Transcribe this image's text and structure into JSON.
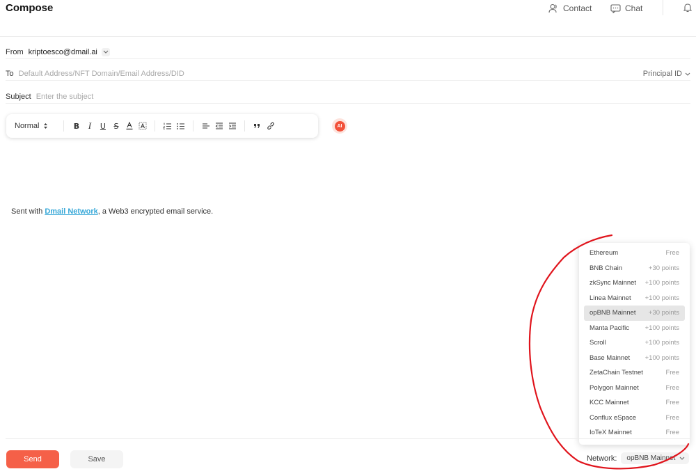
{
  "header": {
    "title": "Compose",
    "contact_label": "Contact",
    "chat_label": "Chat",
    "icons": [
      "contact-icon",
      "chat-icon",
      "bell-icon"
    ]
  },
  "form": {
    "from_label": "From",
    "from_value": "kriptoesco@dmail.ai",
    "to_label": "To",
    "to_placeholder": "Default Address/NFT Domain/Email Address/DID",
    "principal_label": "Principal ID",
    "subject_label": "Subject",
    "subject_placeholder": "Enter the subject"
  },
  "toolbar": {
    "format_value": "Normal",
    "bold": "B",
    "italic": "I",
    "underline": "U",
    "strike": "S",
    "font_color": "A",
    "ai_label": "AI",
    "icons": [
      "text-color-icon",
      "highlight-icon",
      "ordered-list-icon",
      "bullet-list-icon",
      "align-icon",
      "outdent-icon",
      "indent-icon",
      "quote-icon",
      "link-icon"
    ]
  },
  "body": {
    "sig_prefix": "Sent with ",
    "sig_link": "Dmail Network",
    "sig_suffix": ", a Web3 encrypted email service."
  },
  "network_dropdown": {
    "items": [
      {
        "name": "Ethereum",
        "points": "Free"
      },
      {
        "name": "BNB Chain",
        "points": "+30 points"
      },
      {
        "name": "zkSync Mainnet",
        "points": "+100 points"
      },
      {
        "name": "Linea Mainnet",
        "points": "+100 points"
      },
      {
        "name": "opBNB Mainnet",
        "points": "+30 points"
      },
      {
        "name": "Manta Pacific",
        "points": "+100 points"
      },
      {
        "name": "Scroll",
        "points": "+100 points"
      },
      {
        "name": "Base Mainnet",
        "points": "+100 points"
      },
      {
        "name": "ZetaChain Testnet",
        "points": "Free"
      },
      {
        "name": "Polygon Mainnet",
        "points": "Free"
      },
      {
        "name": "KCC Mainnet",
        "points": "Free"
      },
      {
        "name": "Conflux eSpace",
        "points": "Free"
      },
      {
        "name": "IoTeX Mainnet",
        "points": "Free"
      }
    ],
    "selected": "opBNB Mainnet"
  },
  "footer": {
    "send_label": "Send",
    "save_label": "Save",
    "network_label": "Network:",
    "network_value": "opBNB Mainnet"
  },
  "colors": {
    "accent": "#f56048",
    "link": "#37a8d8",
    "annotation": "#e0141c"
  }
}
